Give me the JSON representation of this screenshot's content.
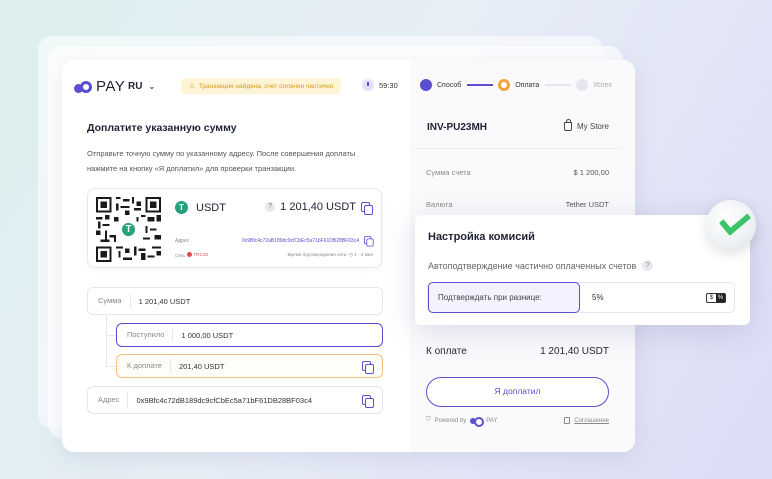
{
  "header": {
    "logo_text": "PAY",
    "language": "RU",
    "warning": "Транзакция найдена, счет оплачен частично",
    "timer": "59:30",
    "steps": [
      {
        "label": "Способ",
        "state": "done"
      },
      {
        "label": "Оплата",
        "state": "current"
      },
      {
        "label": "Успех",
        "state": "todo"
      }
    ]
  },
  "left": {
    "title": "Доплатите указанную сумму",
    "instructions": "Отправьте точную сумму по указанному адресу. После совершения доплаты нажмите на кнопку «Я доплатил» для проверки транзакции.",
    "coin": "USDT",
    "coin_amount": "1 201,40 USDT",
    "address_label": "Адрес",
    "address_value": "0x9Bfc4c72aB189dc9cfCbEc5a71bF61DB28BF03c4",
    "network_label": "Сеть",
    "network_value": "TRC20",
    "confirm_label": "Время подтверждения сети",
    "confirm_value": "1 - 3 мин",
    "sum_label": "Сумма",
    "sum_value": "1 201,40 USDT",
    "received_label": "Поступило",
    "received_value": "1 000,00 USDT",
    "due_label": "К доплате",
    "due_value": "201,40 USDT",
    "addr_field_label": "Адрес",
    "addr_field_value": "0x9Bfc4c72dB189dc9cfCbEc5a71bF61DB28BF03c4"
  },
  "right": {
    "invoice": "INV-PU23MH",
    "store": "My Store",
    "rows": [
      {
        "label": "Сумма счета",
        "value": "$ 1 200,00"
      },
      {
        "label": "Валюта",
        "value": "Tether USDT"
      }
    ],
    "pay_label": "К оплате",
    "pay_value": "1 201,40 USDT",
    "pay_button": "Я доплатил",
    "powered_by": "Powered by",
    "powered_brand": "PAY",
    "terms": "Соглашение"
  },
  "floating": {
    "title": "Настройка комисий",
    "subtitle": "Автоподтверждение частично оплаченных счетов",
    "field_label": "Подтверждать при разнице:",
    "field_value": "5%",
    "toggle_left": "$",
    "toggle_right": "%"
  },
  "colors": {
    "accent": "#5a4fcf",
    "warning_bg": "#fff4d6",
    "warning_text": "#d49a1c",
    "success": "#3cc46a",
    "tether": "#27a17b"
  }
}
